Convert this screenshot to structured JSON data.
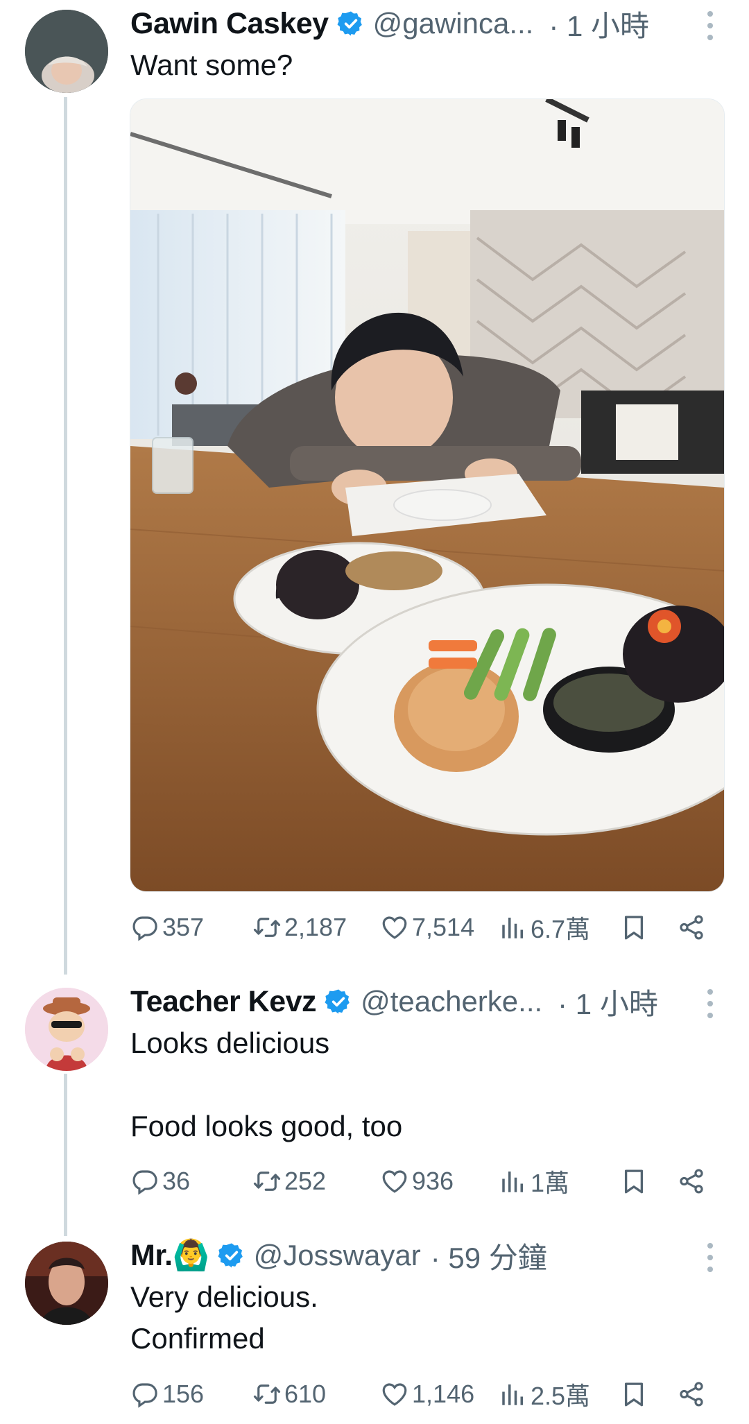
{
  "tweets": [
    {
      "name": "Gawin Caskey",
      "handle": "@gawinca...",
      "time": "· 1 小時",
      "text": [
        "Want some?"
      ],
      "stats": {
        "replies": "357",
        "retweets": "2,187",
        "likes": "7,514",
        "views": "6.7萬"
      }
    },
    {
      "name": "Teacher Kevz",
      "handle": "@teacherke...",
      "time": "· 1 小時",
      "text": [
        "Looks delicious",
        "",
        "Food looks good, too"
      ],
      "stats": {
        "replies": "36",
        "retweets": "252",
        "likes": "936",
        "views": "1萬"
      }
    },
    {
      "name": "Mr.🙆‍♂️",
      "handle": "@Josswayar",
      "time": "· 59 分鐘",
      "text": [
        "Very delicious.",
        "Confirmed"
      ],
      "stats": {
        "replies": "156",
        "retweets": "610",
        "likes": "1,146",
        "views": "2.5萬"
      }
    }
  ],
  "icons": {
    "reply": "reply-icon",
    "retweet": "retweet-icon",
    "like": "like-icon",
    "views": "views-icon",
    "bookmark": "bookmark-icon",
    "share": "share-icon",
    "verified": "verified-badge-icon",
    "more": "more-icon"
  },
  "colors": {
    "verified": "#1d9bf0",
    "secondary_text": "#536471",
    "thread_line": "#cfd9de"
  }
}
